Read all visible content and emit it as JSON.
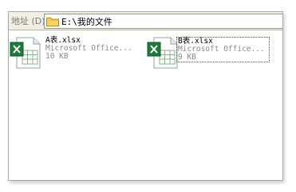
{
  "address_bar": {
    "label": "地址 (D)",
    "path": "E:\\我的文件"
  },
  "files": [
    {
      "name": "A表.xlsx",
      "type": "Microsoft Office...",
      "size": "10 KB",
      "icon": "excel-file-icon"
    },
    {
      "name": "B表.xlsx",
      "type": "Microsoft Office...",
      "size": "9 KB",
      "icon": "excel-file-icon",
      "selected": true
    }
  ],
  "colors": {
    "address_bar_bg": "#f1efe2",
    "field_border": "#7f9db9",
    "excel_green": "#1d7a3b",
    "muted_text": "#8a8a8a"
  }
}
